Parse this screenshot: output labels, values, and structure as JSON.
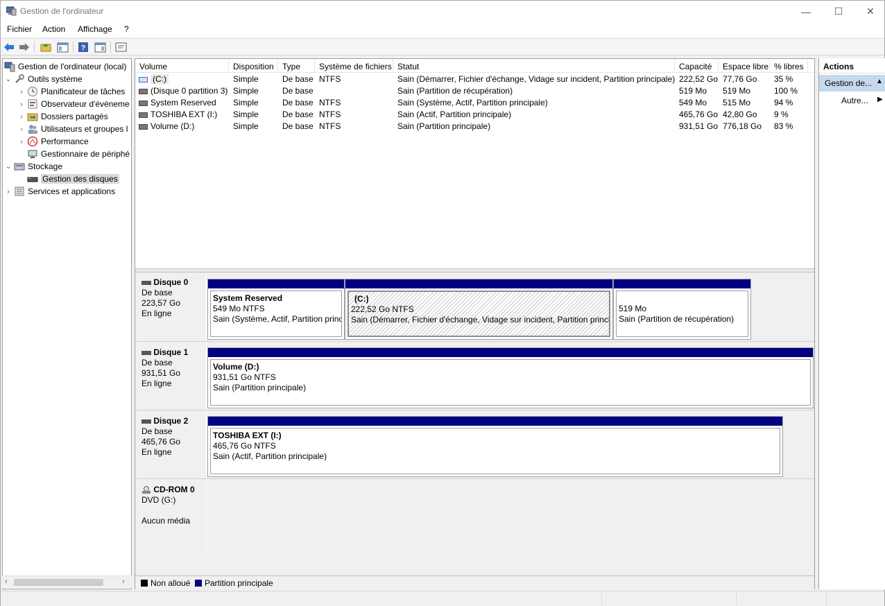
{
  "window": {
    "title": "Gestion de l'ordinateur",
    "minimize_glyph": "—",
    "maximize_glyph": "☐",
    "close_glyph": "✕"
  },
  "menu": {
    "items": [
      "Fichier",
      "Action",
      "Affichage",
      "?"
    ]
  },
  "toolbar": {
    "icons": [
      "back-arrow-icon",
      "forward-arrow-icon",
      "up-folder-icon",
      "show-hide-console-tree-icon",
      "help-icon",
      "show-hide-action-pane-icon",
      "properties-icon"
    ]
  },
  "tree": {
    "root": "Gestion de l'ordinateur (local)",
    "items": [
      {
        "label": "Outils système",
        "icon": "tools-icon",
        "expanded": true
      },
      {
        "label": "Planificateur de tâches",
        "icon": "clock-icon"
      },
      {
        "label": "Observateur d'événeme",
        "icon": "event-viewer-icon"
      },
      {
        "label": "Dossiers partagés",
        "icon": "shared-folder-icon"
      },
      {
        "label": "Utilisateurs et groupes l",
        "icon": "users-icon"
      },
      {
        "label": "Performance",
        "icon": "performance-icon"
      },
      {
        "label": "Gestionnaire de périphé",
        "icon": "device-manager-icon"
      },
      {
        "label": "Stockage",
        "icon": "storage-icon",
        "expanded": true
      },
      {
        "label": "Gestion des disques",
        "icon": "disk-icon",
        "selected": true
      },
      {
        "label": "Services et applications",
        "icon": "services-icon"
      }
    ]
  },
  "volumes": {
    "columns": [
      "Volume",
      "Disposition",
      "Type",
      "Système de fichiers",
      "Statut",
      "Capacité",
      "Espace libre",
      "% libres"
    ],
    "rows": [
      {
        "volume": "(C:)",
        "disposition": "Simple",
        "type": "De base",
        "fs": "NTFS",
        "status": "Sain (Démarrer, Fichier d'échange, Vidage sur incident, Partition principale)",
        "capacity": "222,52 Go",
        "free": "77,76 Go",
        "pct": "35 %"
      },
      {
        "volume": "(Disque 0 partition 3)",
        "disposition": "Simple",
        "type": "De base",
        "fs": "",
        "status": "Sain (Partition de récupération)",
        "capacity": "519 Mo",
        "free": "519 Mo",
        "pct": "100 %"
      },
      {
        "volume": "System Reserved",
        "disposition": "Simple",
        "type": "De base",
        "fs": "NTFS",
        "status": "Sain (Système, Actif, Partition principale)",
        "capacity": "549 Mo",
        "free": "515 Mo",
        "pct": "94 %"
      },
      {
        "volume": "TOSHIBA EXT (I:)",
        "disposition": "Simple",
        "type": "De base",
        "fs": "NTFS",
        "status": "Sain (Actif, Partition principale)",
        "capacity": "465,76 Go",
        "free": "42,80 Go",
        "pct": "9 %"
      },
      {
        "volume": "Volume (D:)",
        "disposition": "Simple",
        "type": "De base",
        "fs": "NTFS",
        "status": "Sain (Partition principale)",
        "capacity": "931,51 Go",
        "free": "776,18 Go",
        "pct": "83 %"
      }
    ]
  },
  "disks": [
    {
      "name": "Disque 0",
      "type": "De base",
      "size": "223,57 Go",
      "state": "En ligne",
      "partitions": [
        {
          "title": "System Reserved",
          "size": "549 Mo NTFS",
          "status": "Sain (Système, Actif, Partition princ"
        },
        {
          "title": "(C:)",
          "size": "222,52 Go NTFS",
          "status": "Sain (Démarrer, Fichier d'échange, Vidage sur incident, Partition princip"
        },
        {
          "title": "",
          "size": "519 Mo",
          "status": "Sain (Partition de récupération)"
        }
      ]
    },
    {
      "name": "Disque 1",
      "type": "De base",
      "size": "931,51 Go",
      "state": "En ligne",
      "partitions": [
        {
          "title": "Volume  (D:)",
          "size": "931,51 Go NTFS",
          "status": "Sain (Partition principale)"
        }
      ]
    },
    {
      "name": "Disque 2",
      "type": "De base",
      "size": "465,76 Go",
      "state": "En ligne",
      "partitions": [
        {
          "title": "TOSHIBA EXT  (I:)",
          "size": "465,76 Go NTFS",
          "status": "Sain (Actif, Partition principale)"
        }
      ]
    },
    {
      "name": "CD-ROM 0",
      "type": "DVD (G:)",
      "size": "",
      "state": "Aucun média"
    }
  ],
  "legend": {
    "unallocated": "Non alloué",
    "unallocated_color": "#000000",
    "primary": "Partition principale",
    "primary_color": "#000080"
  },
  "actions": {
    "header": "Actions",
    "section": "Gestion de...",
    "item": "Autre..."
  }
}
